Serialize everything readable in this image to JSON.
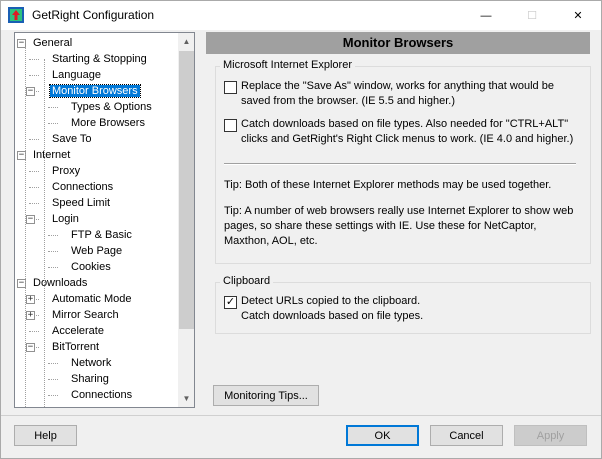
{
  "window": {
    "title": "GetRight Configuration",
    "controls": {
      "minimize": "—",
      "maximize": "☐",
      "close": "✕"
    }
  },
  "tree": {
    "items": [
      {
        "label": "General",
        "level": 0,
        "expander": "−"
      },
      {
        "label": "Starting & Stopping",
        "level": 1
      },
      {
        "label": "Language",
        "level": 1
      },
      {
        "label": "Monitor Browsers",
        "level": 1,
        "expander": "−",
        "selected": true
      },
      {
        "label": "Types & Options",
        "level": 2
      },
      {
        "label": "More Browsers",
        "level": 2
      },
      {
        "label": "Save To",
        "level": 1
      },
      {
        "label": "Internet",
        "level": 0,
        "expander": "−"
      },
      {
        "label": "Proxy",
        "level": 1
      },
      {
        "label": "Connections",
        "level": 1
      },
      {
        "label": "Speed Limit",
        "level": 1
      },
      {
        "label": "Login",
        "level": 1,
        "expander": "−"
      },
      {
        "label": "FTP & Basic",
        "level": 2
      },
      {
        "label": "Web Page",
        "level": 2
      },
      {
        "label": "Cookies",
        "level": 2
      },
      {
        "label": "Downloads",
        "level": 0,
        "expander": "−"
      },
      {
        "label": "Automatic Mode",
        "level": 1,
        "expander": "+"
      },
      {
        "label": "Mirror Search",
        "level": 1,
        "expander": "+"
      },
      {
        "label": "Accelerate",
        "level": 1
      },
      {
        "label": "BitTorrent",
        "level": 1,
        "expander": "−"
      },
      {
        "label": "Network",
        "level": 2
      },
      {
        "label": "Sharing",
        "level": 2
      },
      {
        "label": "Connections",
        "level": 2
      }
    ],
    "scroll_up": "▲",
    "scroll_down": "▼"
  },
  "panel": {
    "title": "Monitor Browsers",
    "ie_group": {
      "title": "Microsoft Internet Explorer",
      "opt1": {
        "checked": false,
        "line1": "Replace the \"Save As\" window, works for anything that would be",
        "line2": "saved from the browser.  (IE 5.5 and higher.)"
      },
      "opt2": {
        "checked": false,
        "line1": "Catch downloads based on file types.  Also needed for \"CTRL+ALT\"",
        "line2": "clicks and GetRight's Right Click menus to work.  (IE 4.0 and higher.)"
      },
      "tip1": "Tip: Both of these Internet Explorer methods may be used together.",
      "tip2_line1": "Tip: A number of web browsers really use Internet Explorer to show web",
      "tip2_line2": "pages, so share these settings with IE.  Use these for NetCaptor,",
      "tip2_line3": "Maxthon, AOL, etc."
    },
    "clipboard_group": {
      "title": "Clipboard",
      "opt": {
        "checked": true,
        "mark": "✓",
        "line1": "Detect URLs copied to the clipboard.",
        "line2": "Catch downloads based on file types."
      }
    },
    "monitoring_tips_label": "Monitoring Tips..."
  },
  "footer": {
    "help": "Help",
    "ok": "OK",
    "cancel": "Cancel",
    "apply": "Apply"
  }
}
